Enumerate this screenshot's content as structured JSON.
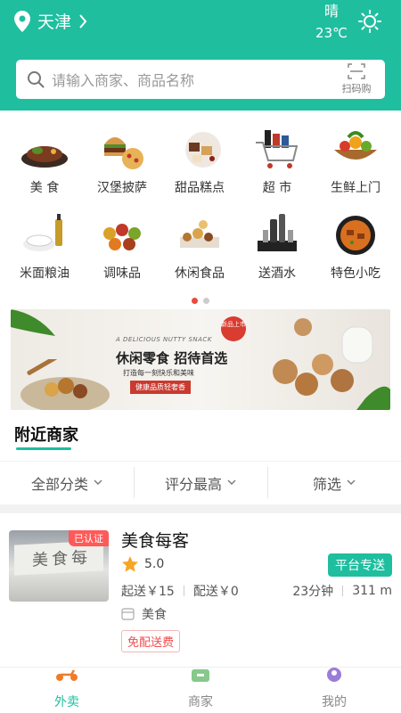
{
  "header": {
    "city": "天津",
    "weather": {
      "condition": "晴",
      "temperature": "23℃"
    },
    "search_placeholder": "请输入商家、商品名称",
    "scan_label": "扫码购"
  },
  "categories": [
    {
      "label": "美 食",
      "icon": "steak-icon"
    },
    {
      "label": "汉堡披萨",
      "icon": "burger-pizza-icon"
    },
    {
      "label": "甜品糕点",
      "icon": "dessert-icon"
    },
    {
      "label": "超 市",
      "icon": "shopping-cart-icon"
    },
    {
      "label": "生鲜上门",
      "icon": "fresh-produce-icon"
    },
    {
      "label": "米面粮油",
      "icon": "rice-oil-icon"
    },
    {
      "label": "调味品",
      "icon": "seasoning-icon"
    },
    {
      "label": "休闲食品",
      "icon": "snacks-icon"
    },
    {
      "label": "送酒水",
      "icon": "liquor-icon"
    },
    {
      "label": "特色小吃",
      "icon": "specialty-snack-icon"
    }
  ],
  "carousel": {
    "pages": 2,
    "active_page": 1
  },
  "banner": {
    "subtitle": "A DELICIOUS NUTTY SNACK",
    "title": "休闲零食  招待首选",
    "tagline": "打造每一刻快乐和美味",
    "tag": "健康品质轻奢香",
    "badge": "新品上市"
  },
  "section_title": "附近商家",
  "filters": [
    "全部分类",
    "评分最高",
    "筛选"
  ],
  "store": {
    "name": "美食每客",
    "verified_label": "已认证",
    "sign_text": "美食每",
    "rating": "5.0",
    "delivery_label": "平台专送",
    "min_order": "起送￥15",
    "delivery_fee": "配送￥0",
    "time": "23分钟",
    "distance": "311 m",
    "category": "美食",
    "promo_tag": "免配送费"
  },
  "nav": [
    {
      "label": "外卖",
      "active": true
    },
    {
      "label": "商家",
      "active": false
    },
    {
      "label": "我的",
      "active": false
    }
  ],
  "colors": {
    "primary": "#1fbe9f",
    "accent_red": "#f24b4b",
    "star": "#f5a623"
  }
}
